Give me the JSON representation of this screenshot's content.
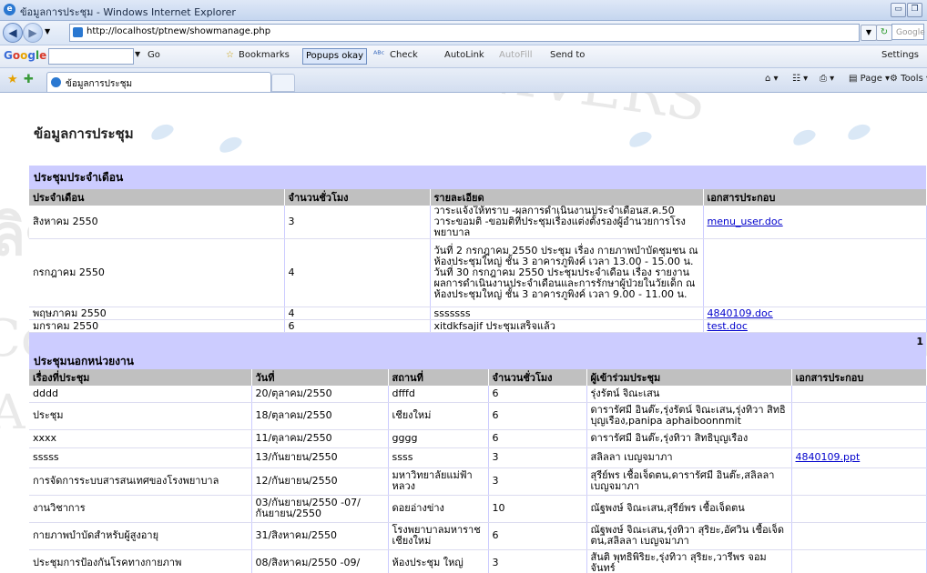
{
  "window": {
    "title": "ข้อมูลการประชุม - Windows Internet Explorer",
    "url": "http://localhost/ptnew/showmanage.php",
    "search_placeholder": "Google",
    "tab_title": "ข้อมูลการประชุม"
  },
  "google_toolbar": {
    "logo": "Google",
    "go_label": "Go",
    "bookmarks": "Bookmarks",
    "popups": "Popups okay",
    "check": "Check",
    "autolink": "AutoLink",
    "autofill": "AutoFill",
    "sendto": "Send to",
    "settings": "Settings"
  },
  "command_bar": {
    "page": "Page",
    "tools": "Tools"
  },
  "page": {
    "title": "ข้อมูลการประชุม",
    "monthly": {
      "heading": "ประชุมประจำเดือน",
      "columns": [
        "ประจำเดือน",
        "จำนวนชั่วโมง",
        "รายละเอียด",
        "เอกสารประกอบ"
      ],
      "rows": [
        {
          "month": "สิงหาคม 2550",
          "hours": "3",
          "detail": "วาระแจ้งให้ทราบ -ผลการดำเนินงานประจำเดือนส.ค.50 วาระขอมติ -ขอมติที่ประชุมเรื่องแต่งตั้งรองผู้อำนวยการโรงพยาบาล",
          "doc": "menu_user.doc"
        },
        {
          "month": "กรกฎาคม 2550",
          "hours": "4",
          "detail": "วันที่ 2 กรกฎาคม 2550 ประชุม เรื่อง กายภาพบำบัดชุมชน ณ ห้องประชุมใหญ่ ชั้น 3 อาคารภูพิงค์ เวลา 13.00 - 15.00 น. วันที่ 30 กรกฎาคม 2550 ประชุมประจำเดือน เรื่อง รายงานผลการดำเนินงานประจำเดือนและการรักษาผู้ป่วยในวัยเด็ก ณ ห้องประชุมใหญ่ ชั้น 3 อาคารภูพิงค์ เวลา 9.00 - 11.00 น.",
          "doc": ""
        },
        {
          "month": "พฤษภาคม 2550",
          "hours": "4",
          "detail": "sssssss",
          "doc": "4840109.doc"
        },
        {
          "month": "มกราคม 2550",
          "hours": "6",
          "detail": "xitdkfsajif ประชุมเสร็จแล้ว",
          "doc": "test.doc"
        }
      ],
      "page_number": "1"
    },
    "external": {
      "heading": "ประชุมนอกหน่วยงาน",
      "columns": [
        "เรื่องที่ประชุม",
        "วันที่",
        "สถานที่",
        "จำนวนชั่วโมง",
        "ผู้เข้าร่วมประชุม",
        "เอกสารประกอบ"
      ],
      "rows": [
        {
          "topic": "dddd",
          "date": "20/ตุลาคม/2550",
          "place": "dfffd",
          "hours": "6",
          "attendees": "รุ่งรัตน์ จิณะเสน",
          "doc": ""
        },
        {
          "topic": "ประชุม",
          "date": "18/ตุลาคม/2550",
          "place": "เชียงใหม่",
          "hours": "6",
          "attendees": "ดารารัศมี อินต๊ะ,รุ่งรัตน์ จิณะเสน,รุ่งทิวา สิทธิบุญเรือง,panipa aphaiboonnmit",
          "doc": ""
        },
        {
          "topic": "xxxx",
          "date": "11/ตุลาคม/2550",
          "place": "gggg",
          "hours": "6",
          "attendees": "ดารารัศมี อินต๊ะ,รุ่งทิวา สิทธิบุญเรือง",
          "doc": ""
        },
        {
          "topic": "sssss",
          "date": "13/กันยายน/2550",
          "place": "ssss",
          "hours": "3",
          "attendees": "สลิลลา เบญจมาภา",
          "doc": "4840109.ppt"
        },
        {
          "topic": "การจัดการระบบสารสนเทศของโรงพยาบาล",
          "date": "12/กันยายน/2550",
          "place": "มหาวิทยาลัยแม่ฟ้าหลวง",
          "hours": "3",
          "attendees": "สุรีย์พร เชื้อเจ็ดตน,ดารารัศมี อินต๊ะ,สลิลลา เบญจมาภา",
          "doc": ""
        },
        {
          "topic": "งานวิชาการ",
          "date": "03/กันยายน/2550 -07/กันยายน/2550",
          "place": "ดอยอ่างข่าง",
          "hours": "10",
          "attendees": "ณัฐพงษ์ จิณะเสน,สุรีย์พร เชื้อเจ็ดตน",
          "doc": ""
        },
        {
          "topic": "กายภาพบำบัดสำหรับผู้สูงอายุ",
          "date": "31/สิงหาคม/2550",
          "place": "โรงพยาบาลมหาราชเชียงใหม่",
          "hours": "6",
          "attendees": "ณัฐพงษ์ จิณะเสน,รุ่งทิวา สุริยะ,อัศวิน เชื้อเจ็ดตน,สลิลลา เบญจมาภา",
          "doc": ""
        },
        {
          "topic": "ประชุมการป้องกันโรคทางกายภาพ",
          "date": "08/สิงหาคม/2550 -09/",
          "place": "ห้องประชุม ใหญ่",
          "hours": "3",
          "attendees": "สันติ พุทธิพิริยะ,รุ่งทิวา สุริยะ,วารีพร จอมจันทร์",
          "doc": ""
        }
      ]
    }
  },
  "watermark": {
    "line1": "MAI UNIVERS",
    "line2": "ลิขสิทธิ์มหาวิทยาลัยเชียงใหม่",
    "line3": "Copyright© by Chiang Mai University",
    "line4": "A l l   r i g h t s   r e s e r v e d"
  }
}
